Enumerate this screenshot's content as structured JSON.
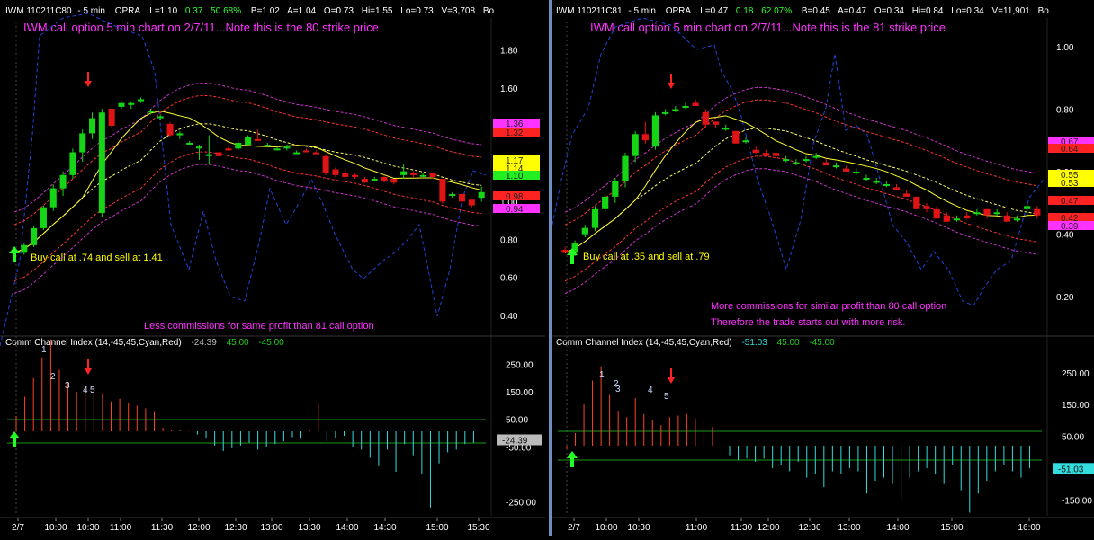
{
  "colors": {
    "background": "#000000",
    "separator": "#6f8fc0",
    "grid": "#2a2a2a",
    "bull_candle": "#16d416",
    "bear_candle": "#e01414",
    "ma_fast": "#ffff33",
    "ma_slow": "#ffff66",
    "bollinger": "#ff3333",
    "keltner": "#cc33cc",
    "blue_line": "#2244dd",
    "cci_positive": "#ff4422",
    "cci_negative": "#33dddd",
    "cci_level": "#1a9a1a",
    "annotation_magenta": "#ff33ff",
    "annotation_yellow": "#ffff00",
    "arrow_green": "#22ff22",
    "arrow_red": "#ff2222",
    "axis_text": "#ffffff"
  },
  "charts": [
    {
      "header": {
        "symbol": "IWM 110211C80",
        "interval": "- 5 min",
        "exchange": "OPRA",
        "last": "L=1.10",
        "change": "0.37",
        "change_pct": "50.68%",
        "bid": "B=1.02",
        "ask": "A=1.04",
        "open": "O=0.73",
        "high": "Hi=1.55",
        "low": "Lo=0.73",
        "volume": "V=3,708",
        "extra": "Bo"
      },
      "title": "IWM call option 5 min chart on 2/7/11...Note this is the 80 strike price",
      "buy_note": "Buy call at .74 and sell at 1.41",
      "comment_lines": [
        "Less commissions for same profit than 81 call option"
      ],
      "cci": {
        "label": "Comm Channel Index (14,-45,45,Cyan,Red)",
        "last": "-24.39",
        "upper": "45.00",
        "lower": "-45.00",
        "ticks": [
          "250.00",
          "150.00",
          "50.00",
          "-50.00",
          "-250.00"
        ],
        "numbers": [
          "1",
          "2",
          "3",
          "4",
          "5"
        ]
      },
      "price_ticks": [
        "1.80",
        "1.60",
        "1.40",
        "1.20",
        "1.00",
        "0.80",
        "0.60",
        "0.40"
      ],
      "price_tags": [
        "1.36",
        "1.32",
        "1.17",
        "1.14",
        "1.10",
        "0.98",
        "0.94"
      ],
      "time_ticks": [
        "2/7",
        "10:00",
        "10:30",
        "11:00",
        "11:30",
        "12:00",
        "12:30",
        "13:00",
        "13:30",
        "14:00",
        "14:30",
        "15:00",
        "15:30"
      ]
    },
    {
      "header": {
        "symbol": "IWM 110211C81",
        "interval": "- 5 min",
        "exchange": "OPRA",
        "last": "L=0.47",
        "change": "0.18",
        "change_pct": "62.07%",
        "bid": "B=0.45",
        "ask": "A=0.47",
        "open": "O=0.34",
        "high": "Hi=0.84",
        "low": "Lo=0.34",
        "volume": "V=11,901",
        "extra": "Bo"
      },
      "title": "IWM call option 5 min chart on 2/7/11...Note this is the 81 strike price",
      "buy_note": "Buy call at .35 and sell at .79",
      "comment_lines": [
        "More commissions for similar profit than 80 call option",
        "Therefore the trade starts out with more risk."
      ],
      "cci": {
        "label": "Comm Channel Index (14,-45,45,Cyan,Red)",
        "last": "-51.03",
        "upper": "45.00",
        "lower": "-45.00",
        "ticks": [
          "250.00",
          "150.00",
          "50.00",
          "-50.00",
          "-150.00"
        ],
        "numbers": [
          "1",
          "2",
          "3",
          "4",
          "5"
        ]
      },
      "price_ticks": [
        "1.00",
        "0.80",
        "0.60",
        "0.40",
        "0.20"
      ],
      "price_tags": [
        "0.67",
        "0.64",
        "0.55",
        "0.53",
        "0.47",
        "0.42",
        "0.39"
      ],
      "time_ticks": [
        "2/7",
        "10:00",
        "10:30",
        "11:00",
        "11:30",
        "12:00",
        "12:30",
        "13:00",
        "14:00",
        "15:00",
        "16:00"
      ]
    }
  ],
  "chart_data": [
    {
      "type": "candlestick",
      "title": "IWM call option 5 min chart on 2/7/11...Note this is the 80 strike price",
      "ylim": [
        0.3,
        1.95
      ],
      "x_categories": [
        "2/7",
        "10:00",
        "10:30",
        "11:00",
        "11:30",
        "12:00",
        "12:30",
        "13:00",
        "13:30",
        "14:00",
        "14:30",
        "15:00",
        "15:30"
      ],
      "ohlc": [
        [
          0.74,
          0.75,
          0.72,
          0.73
        ],
        [
          0.73,
          0.78,
          0.72,
          0.77
        ],
        [
          0.77,
          0.87,
          0.76,
          0.86
        ],
        [
          0.86,
          0.98,
          0.85,
          0.97
        ],
        [
          0.97,
          1.09,
          0.95,
          1.07
        ],
        [
          1.07,
          1.16,
          1.03,
          1.14
        ],
        [
          1.14,
          1.28,
          1.12,
          1.26
        ],
        [
          1.26,
          1.38,
          1.21,
          1.36
        ],
        [
          1.36,
          1.47,
          1.33,
          1.44
        ],
        [
          0.94,
          1.49,
          0.92,
          1.47
        ],
        [
          1.49,
          1.47,
          1.39,
          1.4
        ],
        [
          1.5,
          1.53,
          1.49,
          1.52
        ],
        [
          1.51,
          1.53,
          1.49,
          1.52
        ],
        [
          1.53,
          1.55,
          1.52,
          1.54
        ],
        [
          1.47,
          1.49,
          1.46,
          1.48
        ],
        [
          1.44,
          1.46,
          1.43,
          1.45
        ],
        [
          1.41,
          1.42,
          1.34,
          1.35
        ],
        [
          1.35,
          1.37,
          1.33,
          1.36
        ],
        [
          1.31,
          1.32,
          1.3,
          1.31
        ],
        [
          1.28,
          1.3,
          1.22,
          1.29
        ],
        [
          1.24,
          1.35,
          1.2,
          1.25
        ],
        [
          1.26,
          1.26,
          1.24,
          1.24
        ],
        [
          1.28,
          1.29,
          1.27,
          1.27
        ],
        [
          1.28,
          1.32,
          1.27,
          1.31
        ],
        [
          1.3,
          1.35,
          1.29,
          1.34
        ],
        [
          1.33,
          1.38,
          1.32,
          1.32
        ],
        [
          1.3,
          1.31,
          1.29,
          1.3
        ],
        [
          1.28,
          1.29,
          1.27,
          1.28
        ],
        [
          1.28,
          1.3,
          1.27,
          1.29
        ],
        [
          1.26,
          1.27,
          1.25,
          1.26
        ],
        [
          1.27,
          1.28,
          1.26,
          1.26
        ],
        [
          1.26,
          1.27,
          1.25,
          1.25
        ],
        [
          1.24,
          1.25,
          1.14,
          1.15
        ],
        [
          1.17,
          1.18,
          1.13,
          1.14
        ],
        [
          1.15,
          1.17,
          1.12,
          1.13
        ],
        [
          1.14,
          1.15,
          1.12,
          1.13
        ],
        [
          1.12,
          1.13,
          1.1,
          1.1
        ],
        [
          1.12,
          1.13,
          1.11,
          1.12
        ],
        [
          1.13,
          1.14,
          1.1,
          1.11
        ],
        [
          1.12,
          1.12,
          1.09,
          1.1
        ],
        [
          1.14,
          1.2,
          1.12,
          1.16
        ],
        [
          1.15,
          1.16,
          1.13,
          1.14
        ],
        [
          1.14,
          1.15,
          1.13,
          1.14
        ],
        [
          1.15,
          1.15,
          1.12,
          1.13
        ],
        [
          1.12,
          1.12,
          0.99,
          1.0
        ],
        [
          1.03,
          1.05,
          1.02,
          1.04
        ],
        [
          1.04,
          1.04,
          0.99,
          1.0
        ],
        [
          1.01,
          1.01,
          0.97,
          0.98
        ],
        [
          1.02,
          1.08,
          1.0,
          1.05
        ]
      ],
      "cci": [
        62,
        132,
        200,
        275,
        340,
        230,
        185,
        150,
        165,
        170,
        145,
        115,
        125,
        110,
        100,
        90,
        80,
        20,
        10,
        10,
        8,
        -5,
        -20,
        -45,
        -65,
        -55,
        -45,
        -35,
        -60,
        -50,
        -40,
        -30,
        -15,
        -20,
        10,
        110,
        -30,
        -20,
        -10,
        -50,
        -60,
        -90,
        -120,
        -60,
        -140,
        -40,
        -80,
        -150,
        -270,
        -110,
        -70,
        -60,
        -40,
        -35
      ]
    },
    {
      "type": "candlestick",
      "title": "IWM call option 5 min chart on 2/7/11...Note this is the 81 strike price",
      "ylim": [
        0.08,
        1.08
      ],
      "x_categories": [
        "2/7",
        "10:00",
        "10:30",
        "11:00",
        "11:30",
        "12:00",
        "12:30",
        "13:00",
        "14:00",
        "15:00",
        "16:00"
      ],
      "ohlc": [
        [
          0.35,
          0.36,
          0.34,
          0.34
        ],
        [
          0.34,
          0.38,
          0.33,
          0.37
        ],
        [
          0.4,
          0.43,
          0.39,
          0.42
        ],
        [
          0.42,
          0.49,
          0.41,
          0.48
        ],
        [
          0.48,
          0.53,
          0.47,
          0.52
        ],
        [
          0.52,
          0.58,
          0.5,
          0.57
        ],
        [
          0.57,
          0.66,
          0.55,
          0.65
        ],
        [
          0.65,
          0.73,
          0.63,
          0.72
        ],
        [
          0.72,
          0.76,
          0.69,
          0.7
        ],
        [
          0.68,
          0.79,
          0.67,
          0.78
        ],
        [
          0.79,
          0.8,
          0.78,
          0.79
        ],
        [
          0.8,
          0.81,
          0.79,
          0.8
        ],
        [
          0.81,
          0.82,
          0.8,
          0.81
        ],
        [
          0.82,
          0.83,
          0.81,
          0.81
        ],
        [
          0.79,
          0.8,
          0.74,
          0.75
        ],
        [
          0.76,
          0.76,
          0.74,
          0.75
        ],
        [
          0.74,
          0.75,
          0.73,
          0.74
        ],
        [
          0.73,
          0.73,
          0.69,
          0.69
        ],
        [
          0.7,
          0.71,
          0.69,
          0.7
        ],
        [
          0.67,
          0.68,
          0.66,
          0.66
        ],
        [
          0.66,
          0.67,
          0.65,
          0.65
        ],
        [
          0.66,
          0.66,
          0.65,
          0.65
        ],
        [
          0.64,
          0.65,
          0.63,
          0.64
        ],
        [
          0.63,
          0.64,
          0.62,
          0.63
        ],
        [
          0.64,
          0.65,
          0.63,
          0.64
        ],
        [
          0.65,
          0.66,
          0.64,
          0.65
        ],
        [
          0.63,
          0.64,
          0.62,
          0.62
        ],
        [
          0.62,
          0.63,
          0.61,
          0.62
        ],
        [
          0.61,
          0.62,
          0.6,
          0.6
        ],
        [
          0.6,
          0.61,
          0.59,
          0.6
        ],
        [
          0.58,
          0.59,
          0.57,
          0.58
        ],
        [
          0.57,
          0.58,
          0.56,
          0.57
        ],
        [
          0.56,
          0.57,
          0.55,
          0.56
        ],
        [
          0.55,
          0.56,
          0.54,
          0.54
        ],
        [
          0.53,
          0.54,
          0.52,
          0.52
        ],
        [
          0.52,
          0.52,
          0.48,
          0.48
        ],
        [
          0.49,
          0.5,
          0.47,
          0.48
        ],
        [
          0.48,
          0.49,
          0.45,
          0.45
        ],
        [
          0.46,
          0.47,
          0.44,
          0.44
        ],
        [
          0.45,
          0.46,
          0.44,
          0.45
        ],
        [
          0.46,
          0.47,
          0.45,
          0.45
        ],
        [
          0.47,
          0.48,
          0.46,
          0.47
        ],
        [
          0.48,
          0.48,
          0.45,
          0.46
        ],
        [
          0.47,
          0.48,
          0.46,
          0.47
        ],
        [
          0.46,
          0.47,
          0.44,
          0.44
        ],
        [
          0.45,
          0.46,
          0.44,
          0.45
        ],
        [
          0.48,
          0.5,
          0.46,
          0.49
        ],
        [
          0.48,
          0.49,
          0.45,
          0.46
        ]
      ],
      "cci": [
        10,
        60,
        150,
        225,
        270,
        180,
        130,
        110,
        170,
        120,
        100,
        85,
        110,
        115,
        120,
        105,
        95,
        80,
        20,
        -10,
        -25,
        -20,
        -30,
        -20,
        -50,
        -40,
        -60,
        -30,
        -80,
        -70,
        -110,
        -60,
        -70,
        -50,
        -60,
        -130,
        -90,
        -80,
        -100,
        -150,
        -80,
        -60,
        -50,
        -70,
        -100,
        -40,
        -120,
        -190,
        -130,
        -90,
        -60,
        -40,
        -60,
        -80,
        -50
      ]
    }
  ]
}
